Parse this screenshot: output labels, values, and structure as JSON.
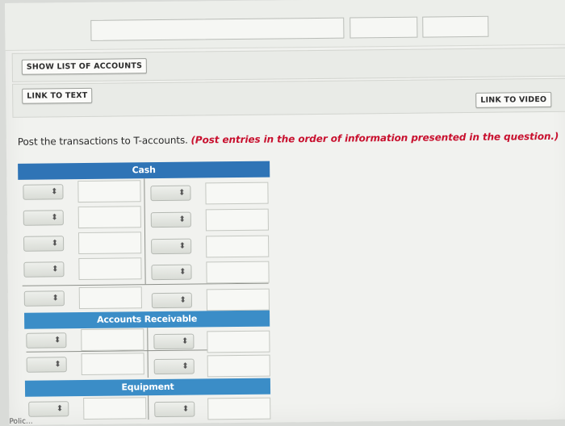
{
  "buttons": {
    "show_list": "SHOW LIST OF ACCOUNTS",
    "link_text": "LINK TO TEXT",
    "link_video": "LINK TO VIDEO"
  },
  "instruction": {
    "main": "Post the transactions to T-accounts. ",
    "hint": "(Post entries in the order of information presented in the question.)"
  },
  "accounts": [
    {
      "name": "Cash",
      "rows": 5
    },
    {
      "name": "Accounts Receivable",
      "rows": 2
    },
    {
      "name": "Equipment",
      "rows": 1
    }
  ],
  "select_icon": "up-down-arrows-icon",
  "footer": "Polic..."
}
